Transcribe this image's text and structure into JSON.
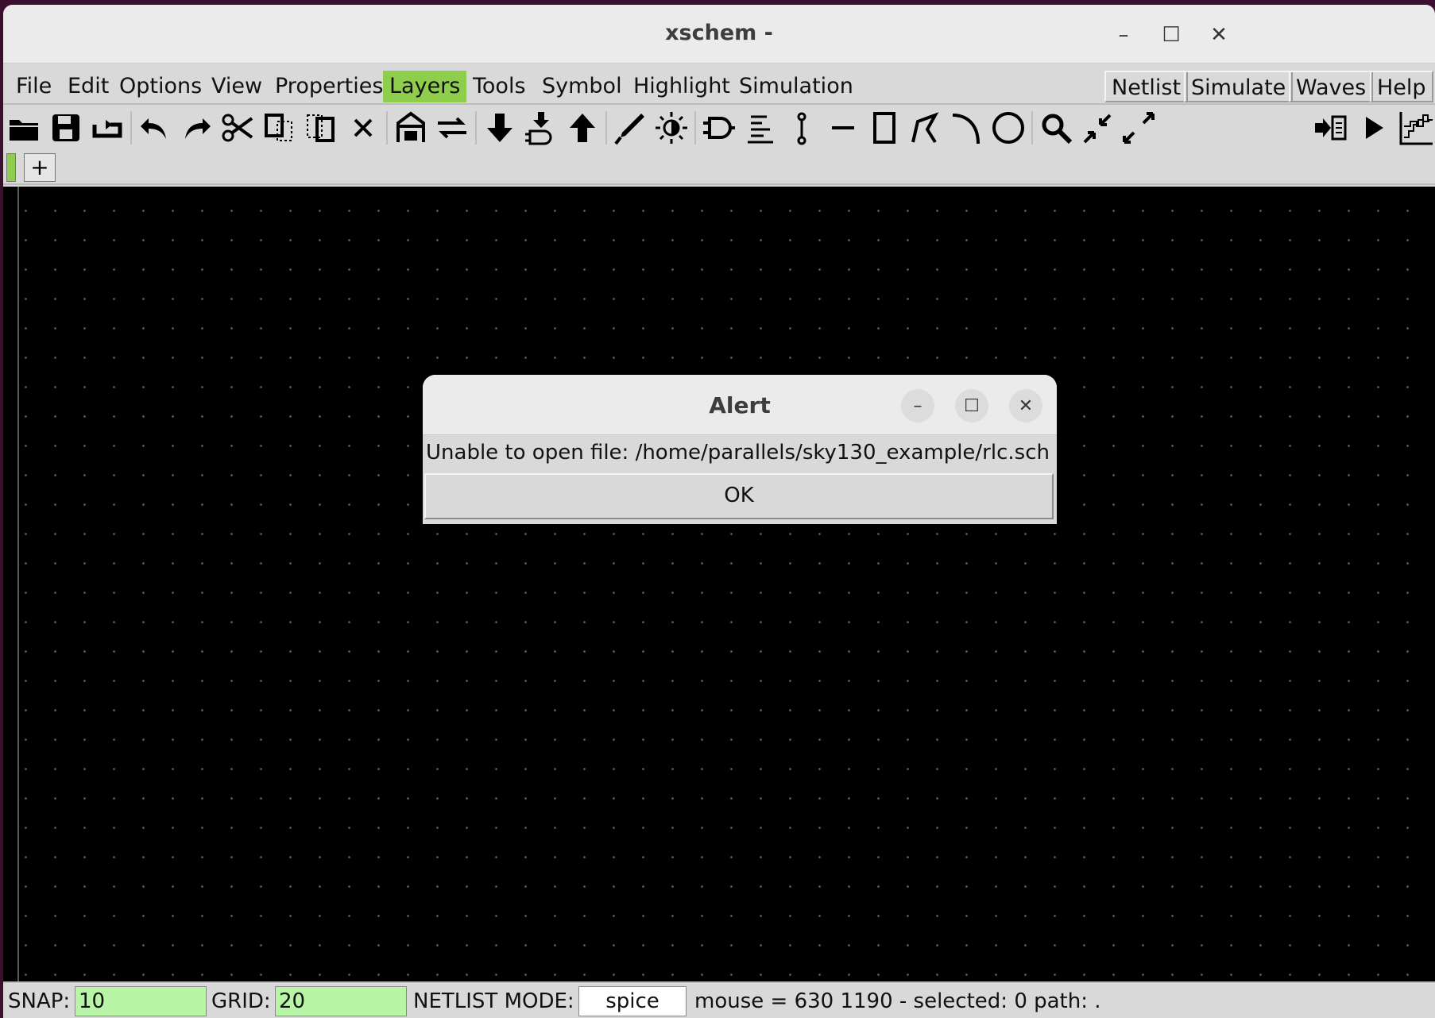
{
  "window": {
    "title": "xschem -"
  },
  "menu": {
    "left": [
      "File",
      "Edit",
      "Options",
      "View",
      "Properties",
      "Layers",
      "Tools",
      "Symbol",
      "Highlight",
      "Simulation"
    ],
    "active": "Layers",
    "right": [
      "Netlist",
      "Simulate",
      "Waves",
      "Help"
    ]
  },
  "toolbar": {
    "icons": [
      "open-icon",
      "save-icon",
      "reload-icon",
      "undo-icon",
      "redo-icon",
      "cut-icon",
      "copy-icon",
      "move-icon",
      "delete-icon",
      "push-icon",
      "pop-icon",
      "descend-icon",
      "descend-symbol-icon",
      "ascend-icon",
      "wire-icon",
      "highlight-icon",
      "symbol-icon",
      "netlabel-icon",
      "pin-icon",
      "line-icon",
      "rect-icon",
      "polygon-icon",
      "arc-icon",
      "circle-icon",
      "zoom-icon",
      "zoom-in-icon",
      "zoom-full-icon",
      "netlist-icon",
      "simulate-icon",
      "waves-icon"
    ]
  },
  "tabs": {
    "add_label": "+"
  },
  "dialog": {
    "title": "Alert",
    "message": "Unable to open file: /home/parallels/sky130_example/rlc.sch",
    "ok_label": "OK"
  },
  "status": {
    "snap_label": "SNAP:",
    "snap_value": "10",
    "grid_label": "GRID:",
    "grid_value": "20",
    "netlist_mode_label": "NETLIST MODE:",
    "netlist_mode_value": "spice",
    "info": "mouse = 630 1190 - selected: 0 path: ."
  },
  "colors": {
    "active_menu": "#8fce4c",
    "status_field": "#b8f5a6",
    "canvas": "#000000"
  }
}
